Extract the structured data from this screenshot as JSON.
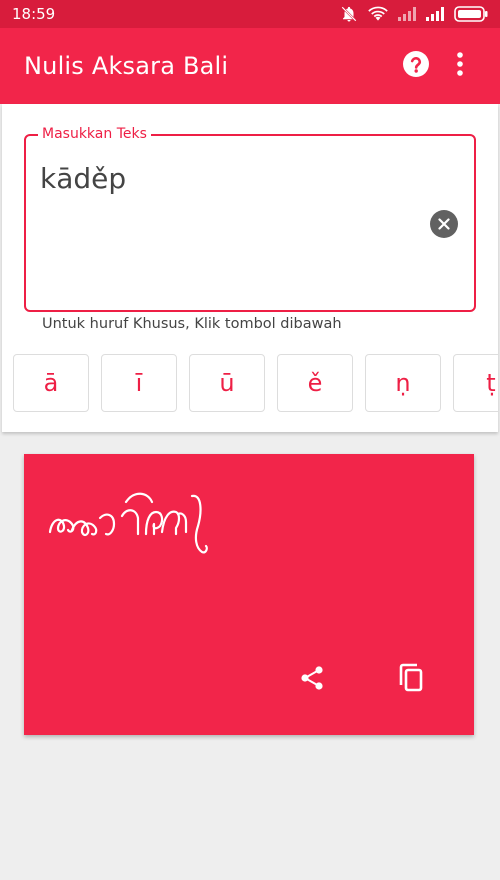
{
  "status_bar": {
    "time": "18:59",
    "icons": [
      "notifications-off-icon",
      "wifi-icon",
      "signal-icon",
      "signal-icon",
      "battery-icon"
    ]
  },
  "app_bar": {
    "title": "Nulis Aksara Bali",
    "actions": [
      "help-icon",
      "more-vert-icon"
    ]
  },
  "input": {
    "label": "Masukkan Teks",
    "value": "kāděp",
    "helper": "Untuk huruf Khusus, Klik tombol dibawah"
  },
  "special_keys": [
    {
      "label": "ā"
    },
    {
      "label": "ī"
    },
    {
      "label": "ū"
    },
    {
      "label": "ě"
    },
    {
      "label": "ṇ"
    },
    {
      "label": "ṭ"
    }
  ],
  "output_card": {
    "script_image": "balinese-script-output",
    "actions": [
      "share-icon",
      "copy-icon"
    ]
  },
  "colors": {
    "primary": "#f2254a",
    "status_bar": "#d81c3c",
    "accent": "#ee1f45",
    "background": "#eeeeee"
  }
}
